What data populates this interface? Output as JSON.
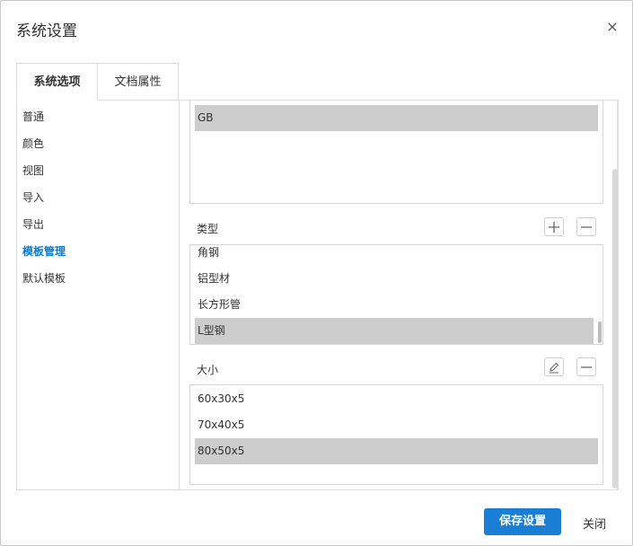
{
  "dialog": {
    "title": "系统设置",
    "close_icon": "close-icon"
  },
  "tabs": [
    {
      "label": "系统选项",
      "active": true
    },
    {
      "label": "文档属性",
      "active": false
    }
  ],
  "sidebar": {
    "items": [
      {
        "label": "普通"
      },
      {
        "label": "颜色"
      },
      {
        "label": "视图"
      },
      {
        "label": "导入"
      },
      {
        "label": "导出"
      },
      {
        "label": "模板管理",
        "active": true
      },
      {
        "label": "默认模板"
      }
    ]
  },
  "standards": {
    "items": [
      "GB"
    ],
    "selected": "GB"
  },
  "types": {
    "label": "类型",
    "add_icon": "plus-icon",
    "remove_icon": "minus-icon",
    "items": [
      "角钢",
      "铝型材",
      "长方形管",
      "L型钢"
    ],
    "selected": "L型钢"
  },
  "sizes": {
    "label": "大小",
    "edit_icon": "edit-icon",
    "remove_icon": "minus-icon",
    "items": [
      "60x30x5",
      "70x40x5",
      "80x50x5"
    ],
    "selected": "80x50x5"
  },
  "footer": {
    "save_label": "保存设置",
    "close_label": "关闭"
  },
  "colors": {
    "accent": "#1a7fd4",
    "active_nav": "#0b7ad1",
    "selection": "#cdcdcd"
  }
}
